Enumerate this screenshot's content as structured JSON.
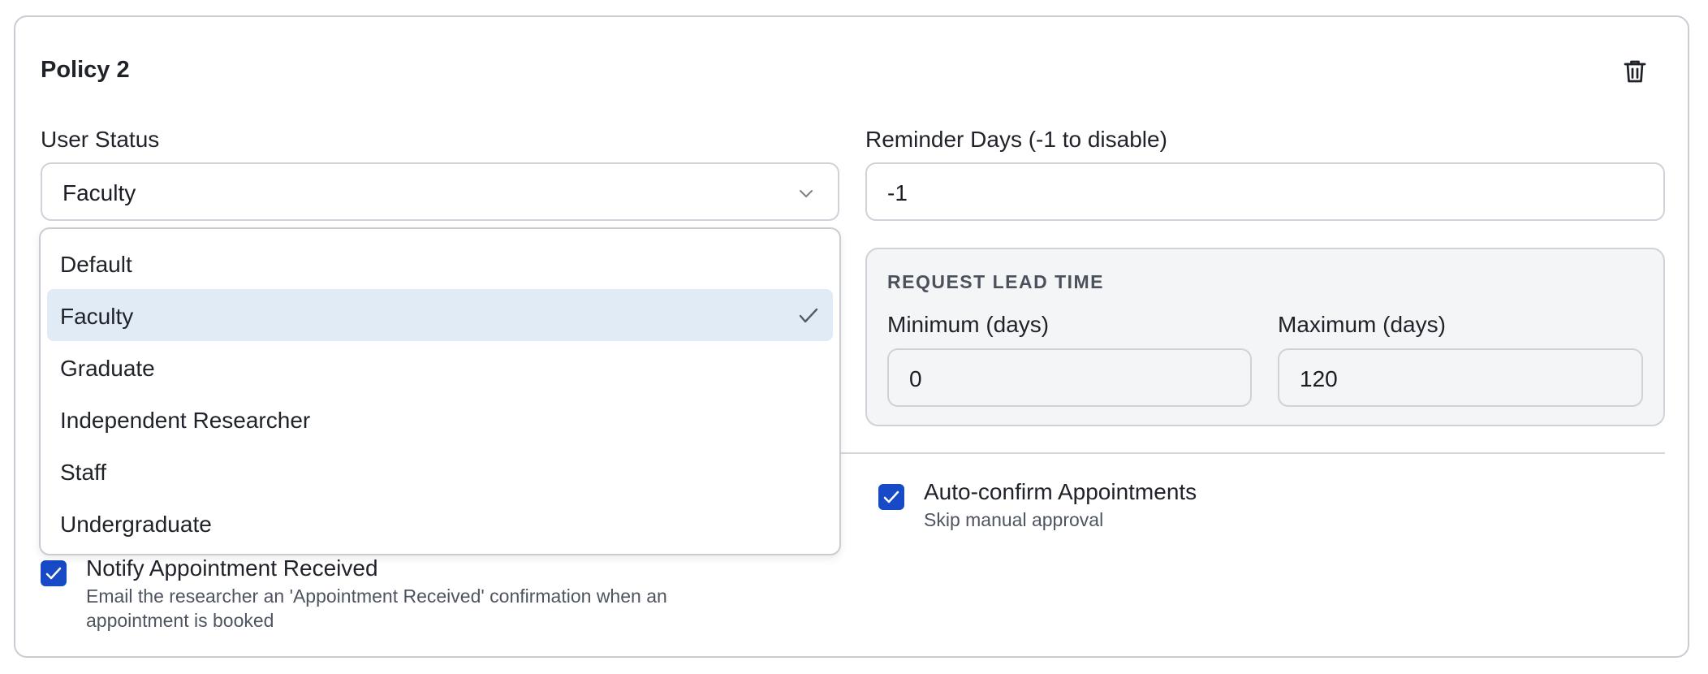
{
  "policy": {
    "title": "Policy 2",
    "delete_icon": "trash-icon"
  },
  "user_status": {
    "label": "User Status",
    "selected": "Faculty",
    "options": [
      "Default",
      "Faculty",
      "Graduate",
      "Independent Researcher",
      "Staff",
      "Undergraduate"
    ]
  },
  "reminder": {
    "label": "Reminder Days (-1 to disable)",
    "value": "-1"
  },
  "lead_time": {
    "heading": "REQUEST LEAD TIME",
    "min_label": "Minimum (days)",
    "min_value": "0",
    "max_label": "Maximum (days)",
    "max_value": "120"
  },
  "auto_confirm": {
    "label": "Auto-confirm Appointments",
    "description": "Skip manual approval",
    "checked": true
  },
  "notify_received": {
    "label": "Notify Appointment Received",
    "description_line1": "Email the researcher an 'Appointment Received' confirmation when an",
    "description_line2": "appointment is booked",
    "checked": true
  },
  "colors": {
    "accent": "#1849c6",
    "selected_option_bg": "#e1ebf5",
    "lead_box_bg": "#f4f5f7",
    "border": "#cfd3d9"
  }
}
